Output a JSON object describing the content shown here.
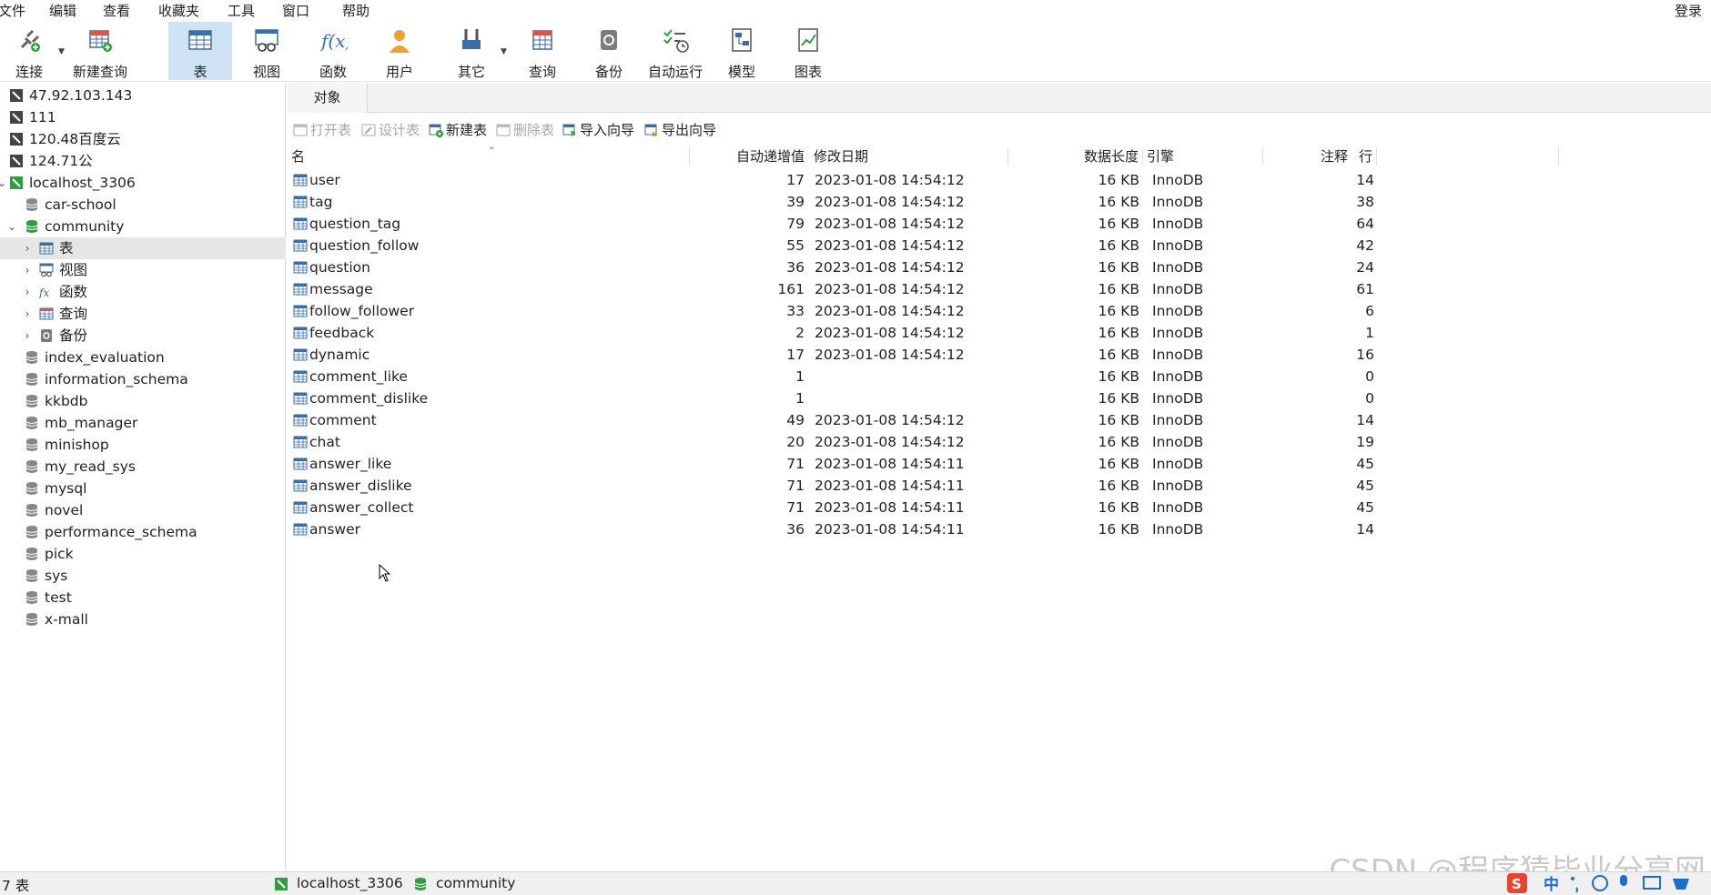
{
  "menu": {
    "items": [
      "文件",
      "编辑",
      "查看",
      "收藏夹",
      "工具",
      "窗口",
      "帮助"
    ],
    "login": "登录"
  },
  "toolbar": {
    "buttons": [
      {
        "label": "连接",
        "icon": "plug-icon"
      },
      {
        "label": "新建查询",
        "icon": "new-query-icon"
      },
      {
        "label": "表",
        "icon": "table-icon"
      },
      {
        "label": "视图",
        "icon": "view-icon"
      },
      {
        "label": "函数",
        "icon": "function-icon"
      },
      {
        "label": "用户",
        "icon": "user-icon"
      },
      {
        "label": "其它",
        "icon": "tools-icon"
      },
      {
        "label": "查询",
        "icon": "query-icon"
      },
      {
        "label": "备份",
        "icon": "backup-icon"
      },
      {
        "label": "自动运行",
        "icon": "schedule-icon"
      },
      {
        "label": "模型",
        "icon": "model-icon"
      },
      {
        "label": "图表",
        "icon": "chart-icon"
      }
    ]
  },
  "sidebar": {
    "connections": [
      "47.92.103.143",
      "111",
      "120.48百度云",
      "124.71公",
      "localhost_3306"
    ],
    "databases_top": [
      "car-school",
      "community"
    ],
    "community_children": [
      "表",
      "视图",
      "函数",
      "查询",
      "备份"
    ],
    "databases_rest": [
      "index_evaluation",
      "information_schema",
      "kkbdb",
      "mb_manager",
      "minishop",
      "my_read_sys",
      "mysql",
      "novel",
      "performance_schema",
      "pick",
      "sys",
      "test",
      "x-mall"
    ]
  },
  "tab": {
    "label": "对象"
  },
  "objbar": {
    "open": "打开表",
    "design": "设计表",
    "new": "新建表",
    "delete": "删除表",
    "import": "导入向导",
    "export": "导出向导"
  },
  "grid": {
    "headers": {
      "name": "名",
      "auto_inc": "自动递增值",
      "modified": "修改日期",
      "data_len": "数据长度",
      "engine": "引擎",
      "rows": "行",
      "comment": "注释"
    },
    "rows": [
      {
        "name": "user",
        "auto_inc": "17",
        "modified": "2023-01-08 14:54:12",
        "data_len": "16 KB",
        "engine": "InnoDB",
        "rows": "14"
      },
      {
        "name": "tag",
        "auto_inc": "39",
        "modified": "2023-01-08 14:54:12",
        "data_len": "16 KB",
        "engine": "InnoDB",
        "rows": "38"
      },
      {
        "name": "question_tag",
        "auto_inc": "79",
        "modified": "2023-01-08 14:54:12",
        "data_len": "16 KB",
        "engine": "InnoDB",
        "rows": "64"
      },
      {
        "name": "question_follow",
        "auto_inc": "55",
        "modified": "2023-01-08 14:54:12",
        "data_len": "16 KB",
        "engine": "InnoDB",
        "rows": "42"
      },
      {
        "name": "question",
        "auto_inc": "36",
        "modified": "2023-01-08 14:54:12",
        "data_len": "16 KB",
        "engine": "InnoDB",
        "rows": "24"
      },
      {
        "name": "message",
        "auto_inc": "161",
        "modified": "2023-01-08 14:54:12",
        "data_len": "16 KB",
        "engine": "InnoDB",
        "rows": "61"
      },
      {
        "name": "follow_follower",
        "auto_inc": "33",
        "modified": "2023-01-08 14:54:12",
        "data_len": "16 KB",
        "engine": "InnoDB",
        "rows": "6"
      },
      {
        "name": "feedback",
        "auto_inc": "2",
        "modified": "2023-01-08 14:54:12",
        "data_len": "16 KB",
        "engine": "InnoDB",
        "rows": "1"
      },
      {
        "name": "dynamic",
        "auto_inc": "17",
        "modified": "2023-01-08 14:54:12",
        "data_len": "16 KB",
        "engine": "InnoDB",
        "rows": "16"
      },
      {
        "name": "comment_like",
        "auto_inc": "1",
        "modified": "",
        "data_len": "16 KB",
        "engine": "InnoDB",
        "rows": "0"
      },
      {
        "name": "comment_dislike",
        "auto_inc": "1",
        "modified": "",
        "data_len": "16 KB",
        "engine": "InnoDB",
        "rows": "0"
      },
      {
        "name": "comment",
        "auto_inc": "49",
        "modified": "2023-01-08 14:54:12",
        "data_len": "16 KB",
        "engine": "InnoDB",
        "rows": "14"
      },
      {
        "name": "chat",
        "auto_inc": "20",
        "modified": "2023-01-08 14:54:12",
        "data_len": "16 KB",
        "engine": "InnoDB",
        "rows": "19"
      },
      {
        "name": "answer_like",
        "auto_inc": "71",
        "modified": "2023-01-08 14:54:11",
        "data_len": "16 KB",
        "engine": "InnoDB",
        "rows": "45"
      },
      {
        "name": "answer_dislike",
        "auto_inc": "71",
        "modified": "2023-01-08 14:54:11",
        "data_len": "16 KB",
        "engine": "InnoDB",
        "rows": "45"
      },
      {
        "name": "answer_collect",
        "auto_inc": "71",
        "modified": "2023-01-08 14:54:11",
        "data_len": "16 KB",
        "engine": "InnoDB",
        "rows": "45"
      },
      {
        "name": "answer",
        "auto_inc": "36",
        "modified": "2023-01-08 14:54:11",
        "data_len": "16 KB",
        "engine": "InnoDB",
        "rows": "14"
      }
    ]
  },
  "status": {
    "count": "7 表",
    "connection": "localhost_3306",
    "database": "community"
  },
  "watermark": "CSDN @程序猿毕业分享网",
  "colors": {
    "accent": "#cfe3f5",
    "db_green": "#2e9e3e",
    "table_blue": "#3a6ea5"
  }
}
